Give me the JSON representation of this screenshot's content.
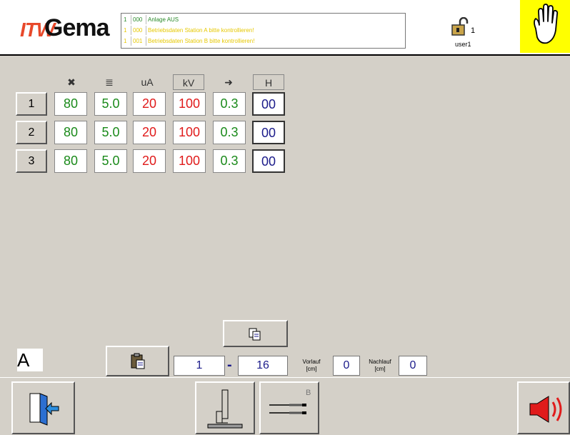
{
  "header": {
    "logo_itw": "ITW",
    "logo_gema": "Gema",
    "messages": [
      {
        "n": "1",
        "code": "000",
        "text": "Anlage AUS",
        "color": "#2a8a2a"
      },
      {
        "n": "1",
        "code": "000",
        "text": "Betriebsdaten Station A bitte kontrollieren!",
        "color": "#e6c800"
      },
      {
        "n": "1",
        "code": "001",
        "text": "Betriebsdaten Station B bitte kontrollieren!",
        "color": "#e6c800"
      }
    ],
    "lock_count": "1",
    "user": "user1"
  },
  "columns": [
    "✖",
    "≣",
    "uA",
    "kV",
    "➜",
    "H"
  ],
  "rows": [
    {
      "id": "1",
      "values": [
        "80",
        "5.0",
        "20",
        "100",
        "0.3",
        "00"
      ]
    },
    {
      "id": "2",
      "values": [
        "80",
        "5.0",
        "20",
        "100",
        "0.3",
        "00"
      ]
    },
    {
      "id": "3",
      "values": [
        "80",
        "5.0",
        "20",
        "100",
        "0.3",
        "00"
      ]
    }
  ],
  "bottom": {
    "station": "A",
    "range_from": "1",
    "range_sep": "-",
    "range_to": "16",
    "vorlauf_label": "Vorlauf",
    "vorlauf_unit": "[cm]",
    "vorlauf_value": "0",
    "nachlauf_label": "Nachlauf",
    "nachlauf_unit": "[cm]",
    "nachlauf_value": "0",
    "b_label": "B"
  },
  "colors": {
    "green": "#1a8a1a",
    "red": "#e01b1b",
    "navy": "#1b1b8a",
    "panel": "#d4d0c8",
    "alarm": "#ffff00"
  }
}
